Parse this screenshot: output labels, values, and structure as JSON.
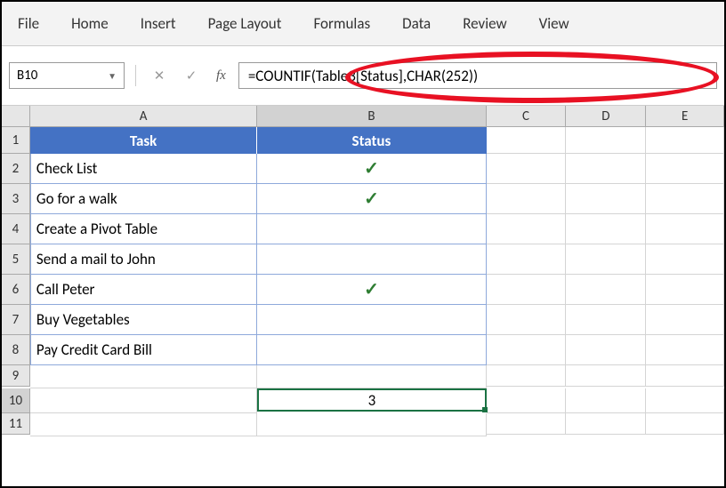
{
  "ribbon": {
    "tabs": [
      "File",
      "Home",
      "Insert",
      "Page Layout",
      "Formulas",
      "Data",
      "Review",
      "View"
    ]
  },
  "nameBox": {
    "value": "B10"
  },
  "formulaBar": {
    "fxLabel": "fx",
    "formula": "=COUNTIF(Table3[Status],CHAR(252))"
  },
  "columns": [
    "A",
    "B",
    "C",
    "D",
    "E"
  ],
  "rowNumbers": [
    "1",
    "2",
    "3",
    "4",
    "5",
    "6",
    "7",
    "8",
    "9",
    "10",
    "11"
  ],
  "table": {
    "headers": {
      "task": "Task",
      "status": "Status"
    },
    "rows": [
      {
        "task": "Check List",
        "status": "✓"
      },
      {
        "task": "Go for a walk",
        "status": "✓"
      },
      {
        "task": "Create a Pivot Table",
        "status": ""
      },
      {
        "task": "Send a mail to John",
        "status": ""
      },
      {
        "task": "Call Peter",
        "status": "✓"
      },
      {
        "task": "Buy Vegetables",
        "status": ""
      },
      {
        "task": "Pay Credit Card Bill",
        "status": ""
      }
    ]
  },
  "result": {
    "value": "3"
  }
}
